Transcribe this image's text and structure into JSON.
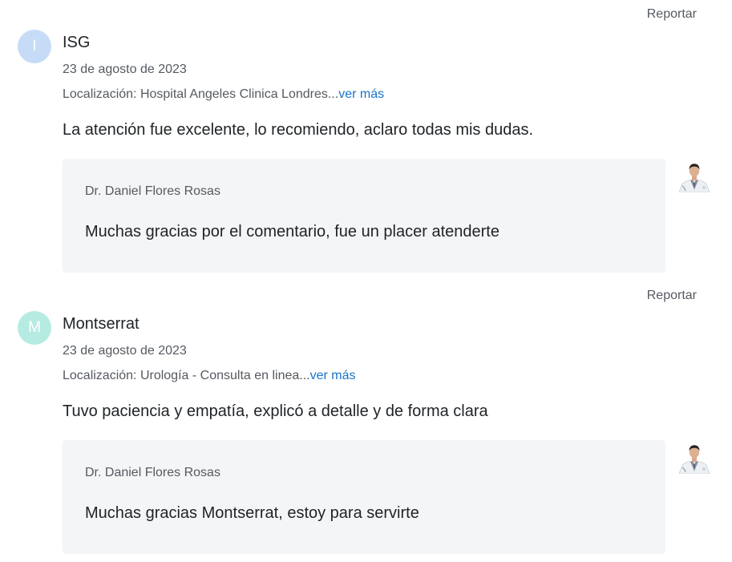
{
  "reviews": [
    {
      "report_label": "Reportar",
      "avatar_letter": "I",
      "avatar_color": "#c6dcf6",
      "author": "ISG",
      "date": "23 de agosto de 2023",
      "location_prefix": "Localización: Hospital Angeles Clinica Londres...",
      "more_label": "ver más",
      "text": "La atención fue excelente, lo recomiendo, aclaro todas mis dudas.",
      "reply": {
        "doctor_name": "Dr. Daniel Flores Rosas",
        "text": "Muchas gracias por el comentario, fue un placer atenderte",
        "photo_icon": "doctor-photo"
      }
    },
    {
      "report_label": "Reportar",
      "avatar_letter": "M",
      "avatar_color": "#b5ebe1",
      "author": "Montserrat",
      "date": "23 de agosto de 2023",
      "location_prefix": "Localización: Urología - Consulta en linea...",
      "more_label": "ver más",
      "text": "Tuvo paciencia y empatía, explicó a detalle y de forma clara",
      "reply": {
        "doctor_name": "Dr. Daniel Flores Rosas",
        "text": "Muchas gracias Montserrat, estoy para servirte",
        "photo_icon": "doctor-photo"
      }
    }
  ],
  "colors": {
    "link": "#1a73c8",
    "reply_background": "#f4f5f7",
    "muted_text": "#555a60",
    "body_text": "#1f2326"
  }
}
